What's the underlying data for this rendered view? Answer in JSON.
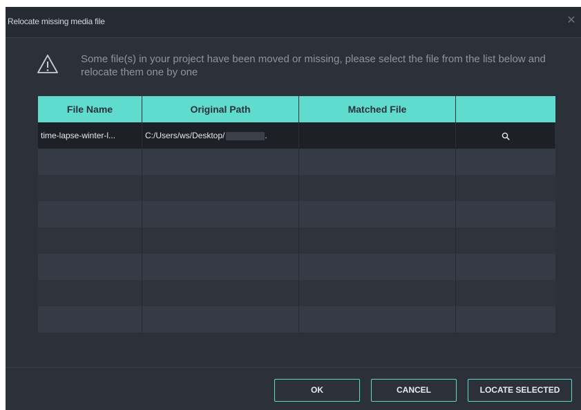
{
  "dialog": {
    "title": "Relocate missing media file",
    "close_glyph": "✕",
    "message": "Some file(s) in your project have been moved or missing, please select the file from the list below and relocate them one by one"
  },
  "table": {
    "headers": [
      "File Name",
      "Original Path",
      "Matched File",
      ""
    ],
    "rows": [
      {
        "file_name": "time-lapse-winter-l...",
        "original_path": "C:/Users/ws/Desktop/",
        "path_suffix": ".",
        "matched_file": ""
      }
    ],
    "empty_rows": 7
  },
  "buttons": {
    "ok": "OK",
    "cancel": "CANCEL",
    "locate": "LOCATE SELECTED"
  },
  "colors": {
    "accent": "#5fdccd",
    "background": "#2b3039",
    "selected_row": "#1d2127"
  },
  "icons": {
    "warning": "warning-icon",
    "search": "search-icon",
    "close": "close-icon"
  }
}
